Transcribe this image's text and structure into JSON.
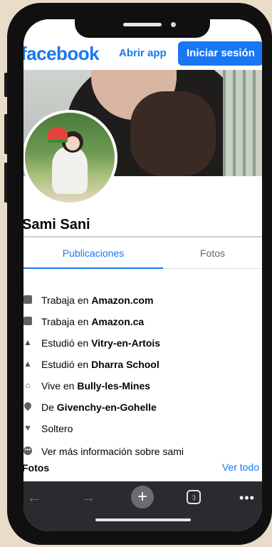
{
  "header": {
    "logo": "facebook",
    "open_app": "Abrir app",
    "login": "Iniciar sesión"
  },
  "profile": {
    "name": "Sami Sani"
  },
  "tabs": [
    {
      "label": "Publicaciones",
      "active": true
    },
    {
      "label": "Fotos",
      "active": false
    }
  ],
  "about": [
    {
      "icon": "briefcase-icon",
      "prefix": "Trabaja en ",
      "bold": "Amazon.com"
    },
    {
      "icon": "briefcase-icon",
      "prefix": "Trabaja en ",
      "bold": "Amazon.ca"
    },
    {
      "icon": "graduation-cap-icon",
      "prefix": "Estudió en ",
      "bold": "Vitry-en-Artois"
    },
    {
      "icon": "graduation-cap-icon",
      "prefix": "Estudió en ",
      "bold": "Dharra School"
    },
    {
      "icon": "house-icon",
      "prefix": "Vive en ",
      "bold": "Bully-les-Mines"
    },
    {
      "icon": "location-pin-icon",
      "prefix": "De ",
      "bold": "Givenchy-en-Gohelle"
    },
    {
      "icon": "heart-icon",
      "prefix": "Soltero",
      "bold": ""
    },
    {
      "icon": "more-dots-icon",
      "prefix": "Ver más información sobre sami",
      "bold": ""
    }
  ],
  "photos": {
    "title": "Fotos",
    "see_all": "Ver todo"
  },
  "toolbar": {
    "back": "←",
    "forward": "→",
    "new_tab": "+",
    "tabs_glyph": ":)",
    "more": "•••"
  },
  "colors": {
    "brand": "#1877f2",
    "toolbar_bg": "#2a2b2e",
    "background": "#e9dcc9"
  }
}
